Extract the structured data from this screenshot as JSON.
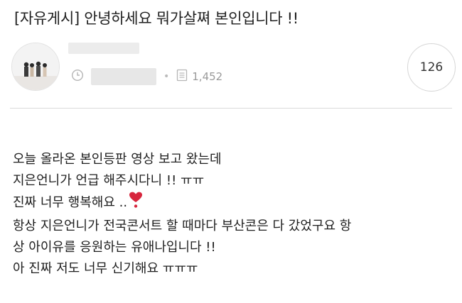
{
  "post": {
    "title": "[자유게시] 안녕하세요 뭐가살쪄 본인입니다 !!",
    "views": "1,452",
    "comment_count": "126"
  },
  "content": {
    "line1": "오늘 올라온 본인등판 영상 보고 왔는데",
    "line2": "지은언니가 언급 해주시다니 !! ㅠㅠ",
    "line3": "진짜 너무 행복해요 ..",
    "line4": "항상 지은언니가 전국콘서트 할 때마다 부산콘은 다 갔었구요 항",
    "line5": "상 아이유를 응원하는 유애나입니다 !!",
    "line6": "아 진짜 저도 너무 신기해요 ㅠㅠㅠ"
  },
  "icons": {
    "clock": "clock-icon",
    "views": "document-icon",
    "heart": "heart-emoji-icon"
  },
  "colors": {
    "heart": "#d7263d",
    "meta": "#9a9a9a"
  }
}
